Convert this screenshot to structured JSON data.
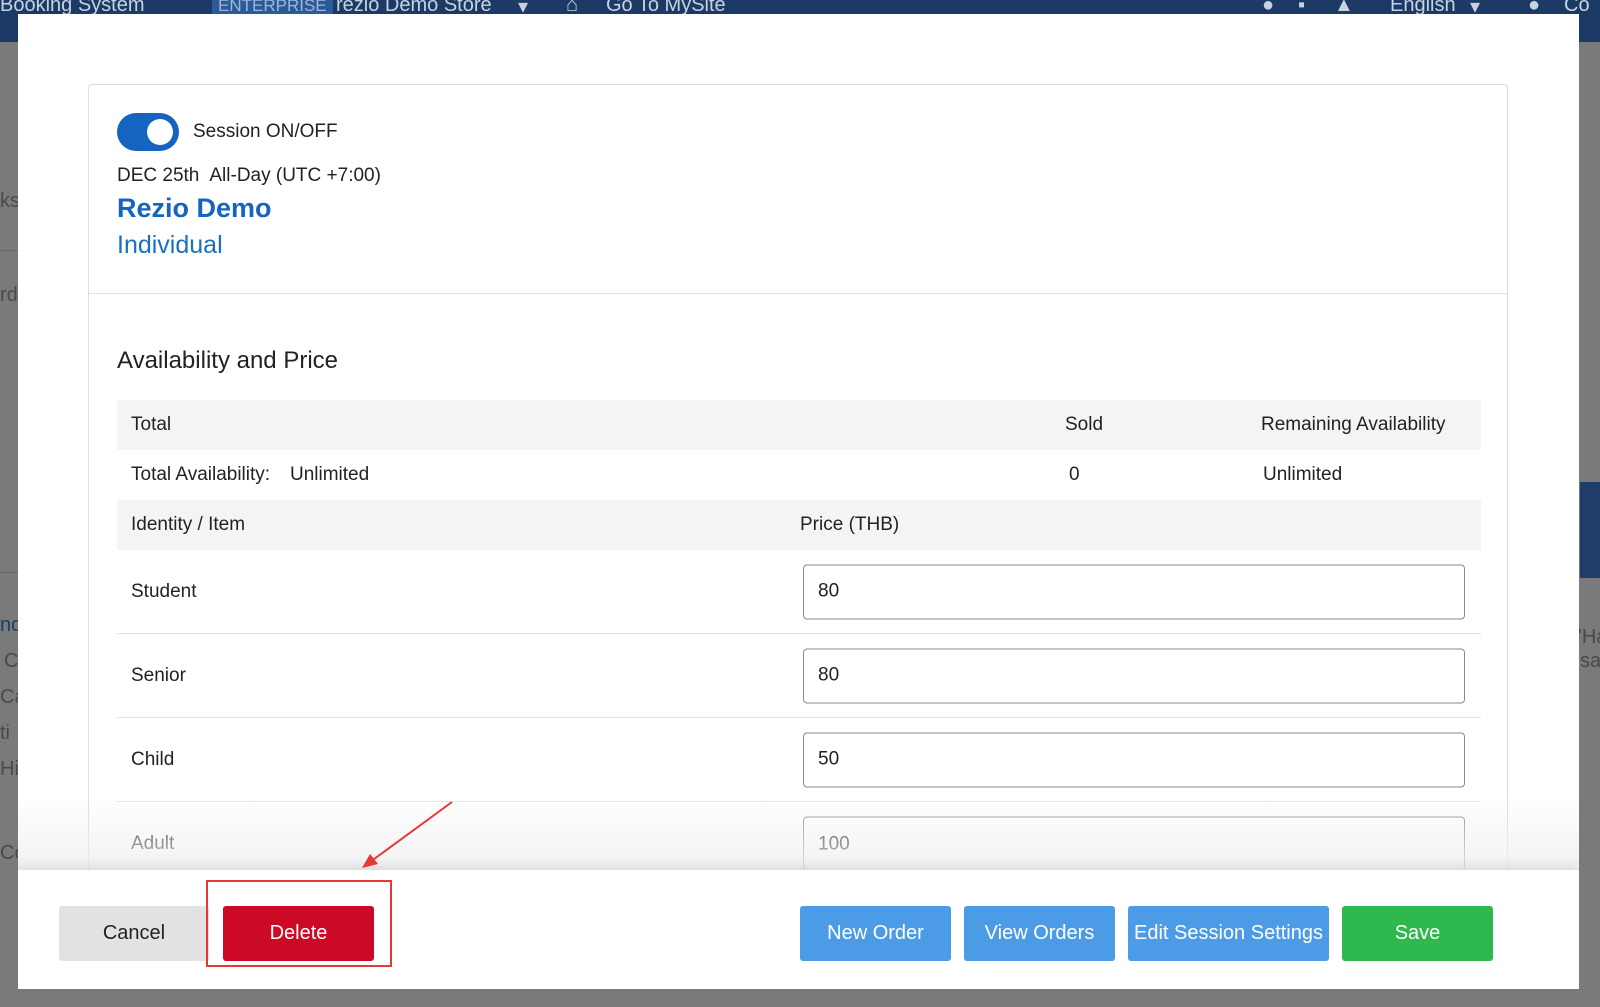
{
  "app": {
    "title": "Booking System",
    "plan_badge": "ENTERPRISE",
    "store_name": "rezio Demo Store",
    "go_to_mysite": "Go To MySite",
    "language": "English",
    "user_fragment": "Co",
    "background_fragments": [
      "ks",
      "rd",
      "nd",
      "C",
      "Ca",
      "ti",
      "Hi",
      "Co",
      "'Ha",
      "sa"
    ]
  },
  "session": {
    "toggle_label": "Session ON/OFF",
    "toggle_on": true,
    "date": "DEC 25th",
    "time": "All-Day (UTC +7:00)",
    "product_name": "Rezio Demo",
    "product_type": "Individual"
  },
  "availability": {
    "section_title": "Availability and Price",
    "headers": {
      "total": "Total",
      "sold": "Sold",
      "remaining": "Remaining Availability"
    },
    "total_row": {
      "label": "Total Availability:",
      "value": "Unlimited",
      "sold": "0",
      "remaining": "Unlimited"
    },
    "item_headers": {
      "identity": "Identity / Item",
      "price": "Price (THB)"
    },
    "items": [
      {
        "name": "Student",
        "price": "80"
      },
      {
        "name": "Senior",
        "price": "80"
      },
      {
        "name": "Child",
        "price": "50"
      },
      {
        "name": "Adult",
        "price": "100"
      }
    ]
  },
  "footer": {
    "cancel": "Cancel",
    "delete": "Delete",
    "new_order": "New Order",
    "view_orders": "View Orders",
    "edit_session_settings": "Edit Session Settings",
    "save": "Save"
  },
  "colors": {
    "primary_blue": "#1565c0",
    "button_blue": "#4c9be6",
    "delete_red": "#cc0a25",
    "save_green": "#2fb84d",
    "annotation_red": "#e53935"
  }
}
